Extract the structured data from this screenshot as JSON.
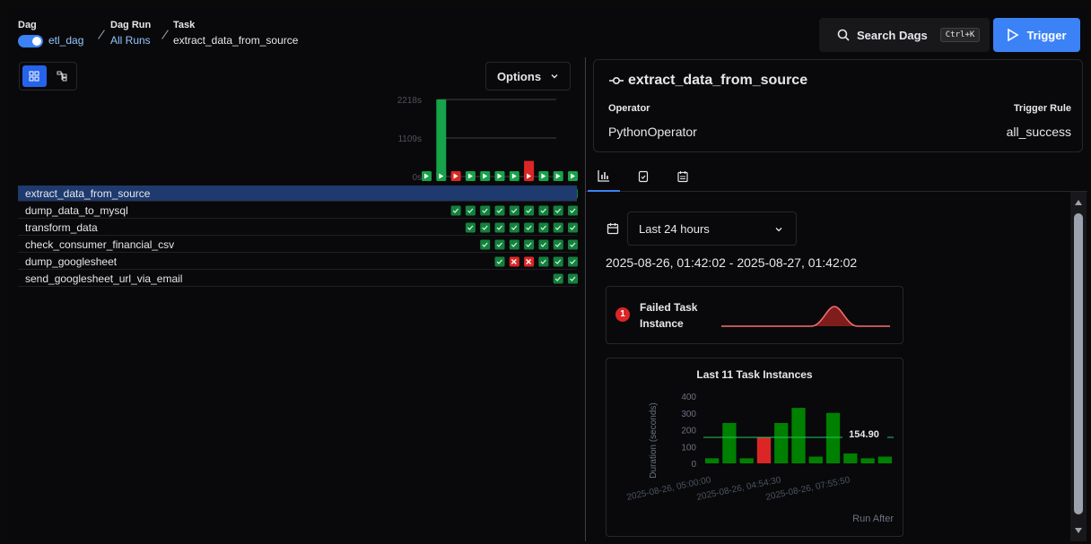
{
  "breadcrumb": {
    "dag_label": "Dag",
    "dag_value": "etl_dag",
    "dagrun_label": "Dag Run",
    "dagrun_value": "All Runs",
    "task_label": "Task",
    "task_value": "extract_data_from_source"
  },
  "header": {
    "search_label": "Search Dags",
    "search_shortcut": "Ctrl+K",
    "trigger_label": "Trigger"
  },
  "grid": {
    "options_label": "Options",
    "y_ticks": [
      "2218s",
      "1109s",
      "0s"
    ],
    "tasks": [
      {
        "name": "extract_data_from_source",
        "states": [
          "s",
          "s",
          "f",
          "s",
          "s",
          "s",
          "s",
          "s",
          "s",
          "s",
          "s"
        ]
      },
      {
        "name": "dump_data_to_mysql",
        "states": [
          "",
          "",
          "s",
          "s",
          "s",
          "s",
          "s",
          "s",
          "s",
          "s",
          "s"
        ]
      },
      {
        "name": "transform_data",
        "states": [
          "",
          "",
          "",
          "s",
          "s",
          "s",
          "s",
          "s",
          "s",
          "s",
          "s"
        ]
      },
      {
        "name": "check_consumer_financial_csv",
        "states": [
          "",
          "",
          "",
          "",
          "s",
          "s",
          "s",
          "s",
          "s",
          "s",
          "s"
        ]
      },
      {
        "name": "dump_googlesheet",
        "states": [
          "",
          "",
          "",
          "",
          "",
          "s",
          "f",
          "f",
          "s",
          "s",
          "s"
        ]
      },
      {
        "name": "send_googlesheet_url_via_email",
        "states": [
          "",
          "",
          "",
          "",
          "",
          "",
          "",
          "",
          "",
          "s",
          "s"
        ]
      }
    ],
    "run_states": [
      "s",
      "s",
      "f",
      "s",
      "s",
      "s",
      "s",
      "f",
      "s",
      "s",
      "s"
    ],
    "run_durations": [
      0,
      2218,
      0,
      0,
      0,
      0,
      0,
      450,
      0,
      0,
      0
    ]
  },
  "details": {
    "task_title": "extract_data_from_source",
    "operator_label": "Operator",
    "operator_value": "PythonOperator",
    "trigger_rule_label": "Trigger Rule",
    "trigger_rule_value": "all_success",
    "date_range_option": "Last 24 hours",
    "date_range_text": "2025-08-26, 01:42:02 - 2025-08-27, 01:42:02",
    "failed_count": "1",
    "failed_label": "Failed Task Instance"
  },
  "chart_data": {
    "type": "bar",
    "title": "Last 11 Task Instances",
    "ylabel": "Duration (seconds)",
    "xlabel": "Run After",
    "ylim": [
      0,
      400
    ],
    "y_ticks": [
      "400",
      "300",
      "200",
      "100",
      "0"
    ],
    "x_tick_labels": [
      "2025-08-26, 05:00:00",
      "2025-08-26, 04:54:30",
      "2025-08-26, 07:55:50"
    ],
    "values": [
      30,
      240,
      30,
      155,
      240,
      330,
      40,
      300,
      60,
      30,
      40
    ],
    "states": [
      "success",
      "success",
      "success",
      "failed",
      "success",
      "success",
      "success",
      "success",
      "success",
      "success",
      "success"
    ],
    "reference_value": 154.9,
    "reference_label": "154.90",
    "colors": {
      "success": "#008000",
      "failed": "#dc2626",
      "reference": "#22c55e"
    }
  }
}
